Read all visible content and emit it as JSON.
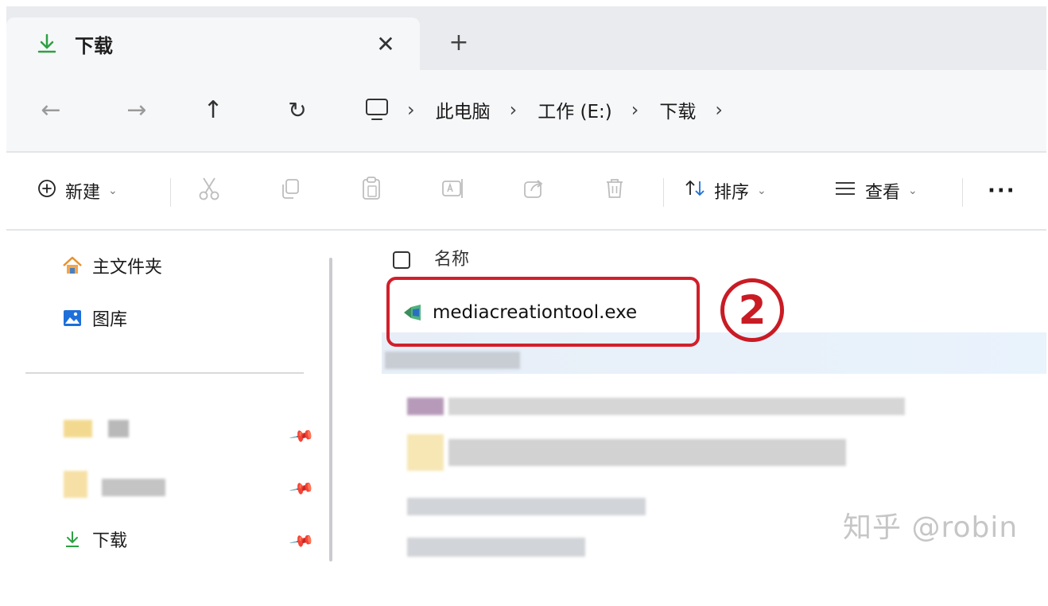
{
  "tab": {
    "title": "下载",
    "close": "✕",
    "new_tab": "+"
  },
  "nav": {
    "back": "←",
    "forward": "→",
    "up": "↑",
    "refresh": "↻",
    "breadcrumbs": [
      {
        "label": "此电脑"
      },
      {
        "label": "工作 (E:)"
      },
      {
        "label": "下载"
      }
    ],
    "separator": "›"
  },
  "toolbar": {
    "new_label": "新建",
    "sort_label": "排序",
    "view_label": "查看",
    "more_label": "···",
    "caret": "⌄"
  },
  "sidebar": {
    "items": [
      {
        "label": "主文件夹"
      },
      {
        "label": "图库"
      },
      {
        "label": "下载"
      }
    ]
  },
  "list": {
    "header_name": "名称",
    "file_name": "mediacreationtool.exe",
    "callout_number": "2"
  },
  "watermark": "知乎 @robin",
  "colors": {
    "accent_green": "#2ea043",
    "callout_red": "#d21f2a",
    "selection": "#e7eef7"
  }
}
